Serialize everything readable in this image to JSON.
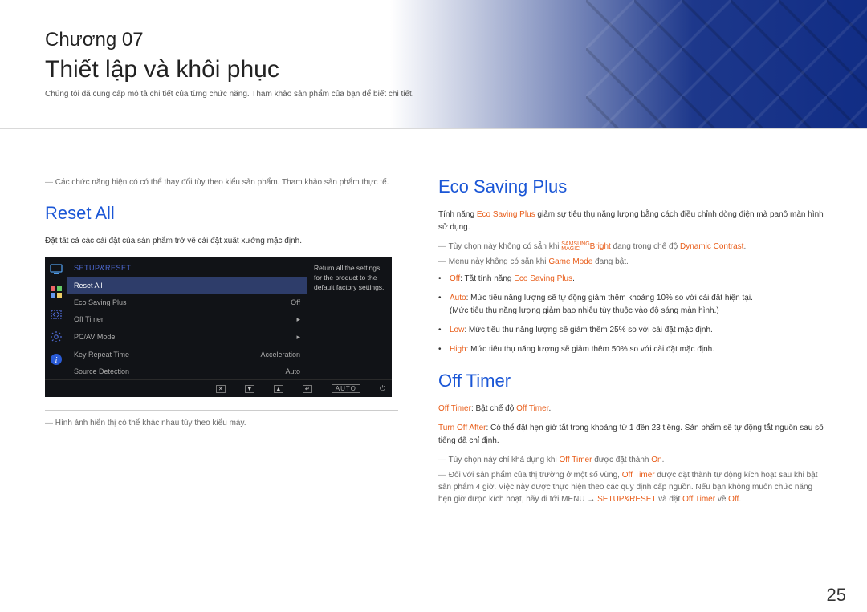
{
  "header": {
    "chapter": "Chương 07",
    "title": "Thiết lập và khôi phục",
    "subtitle": "Chúng tôi đã cung cấp mô tả chi tiết của từng chức năng. Tham khảo sản phẩm của bạn để biết chi tiết."
  },
  "left": {
    "top_note": "Các chức năng hiện có có thể thay đổi tùy theo kiểu sản phẩm. Tham khảo sản phẩm thực tế.",
    "heading": "Reset All",
    "intro": "Đặt tất cả các cài đặt của sản phẩm trở về cài đặt xuất xưởng mặc định.",
    "bottom_note": "Hình ảnh hiển thị có thể khác nhau tùy theo kiểu máy."
  },
  "osd": {
    "title": "SETUP&RESET",
    "desc": "Return all the settings for the product to the default factory settings.",
    "rows": [
      {
        "label": "Reset All",
        "value": "",
        "selected": true
      },
      {
        "label": "Eco Saving Plus",
        "value": "Off",
        "selected": false
      },
      {
        "label": "Off Timer",
        "value": "▸",
        "selected": false
      },
      {
        "label": "PC/AV Mode",
        "value": "▸",
        "selected": false
      },
      {
        "label": "Key Repeat Time",
        "value": "Acceleration",
        "selected": false
      },
      {
        "label": "Source Detection",
        "value": "Auto",
        "selected": false
      }
    ],
    "footer_auto": "AUTO",
    "footer_keys": {
      "close": "✕",
      "down": "▼",
      "up": "▲",
      "enter": "↵",
      "power": "⏻"
    },
    "sidebar_icons": {
      "monitor": "monitor",
      "grid": "grid",
      "resize": "resize",
      "gear": "gear",
      "info": "info"
    }
  },
  "right": {
    "eco": {
      "heading": "Eco Saving Plus",
      "intro_pre": "Tính năng ",
      "intro_hl": "Eco Saving Plus",
      "intro_post": " giảm sự tiêu thụ năng lượng bằng cách điều chỉnh dòng điện mà panô màn hình sử dụng.",
      "note1_pre": "Tùy chọn này không có sẵn khi ",
      "note1_brand_top": "SAMSUNG",
      "note1_brand_bot": "MAGIC",
      "note1_bright": "Bright",
      "note1_mid": " đang trong chế độ ",
      "note1_hl2": "Dynamic Contrast",
      "note1_end": ".",
      "note2_pre": "Menu này không có sẵn khi ",
      "note2_hl": "Game Mode",
      "note2_post": " đang bật.",
      "bullets": {
        "off_key": "Off",
        "off_text": ": Tắt tính năng ",
        "off_hl": "Eco Saving Plus",
        "off_end": ".",
        "auto_key": "Auto",
        "auto_text": ": Mức tiêu năng lượng sẽ tự động giảm thêm khoảng 10% so với cài đặt hiện tại.",
        "auto_sub": "(Mức tiêu thụ năng lượng giảm bao nhiêu tùy thuộc vào độ sáng màn hình.)",
        "low_key": "Low",
        "low_text": ": Mức tiêu thụ năng lượng sẽ giảm thêm 25% so với cài đặt mặc định.",
        "high_key": "High",
        "high_text": ": Mức tiêu thụ năng lượng sẽ giảm thêm 50% so với cài đặt mặc định."
      }
    },
    "offtimer": {
      "heading": "Off Timer",
      "line1_key": "Off Timer",
      "line1_text": ": Bật chế độ ",
      "line1_hl": "Off Timer",
      "line1_end": ".",
      "line2_key": "Turn Off After",
      "line2_text": ": Có thể đặt hẹn giờ tắt trong khoảng từ 1 đến 23 tiếng. Sản phẩm sẽ tự động tắt nguồn sau số tiếng đã chỉ định.",
      "note1_pre": "Tùy chọn này chỉ khả dụng khi ",
      "note1_hl1": "Off Timer",
      "note1_mid": " được đặt thành ",
      "note1_hl2": "On",
      "note1_end": ".",
      "note2_pre": "Đối với sản phẩm của thị trường ở một số vùng, ",
      "note2_hl1": "Off Timer",
      "note2_mid1": " được đặt thành tự động kích hoạt sau khi bật sản phẩm 4 giờ. Việc này được thực hiện theo các quy định cấp nguồn. Nếu bạn không muốn chức năng hẹn giờ được kích hoạt, hãy đi tới MENU → ",
      "note2_hl2": "SETUP&RESET",
      "note2_mid2": " và đặt ",
      "note2_hl3": "Off Timer",
      "note2_mid3": " về ",
      "note2_hl4": "Off",
      "note2_end": "."
    }
  },
  "page_number": "25"
}
